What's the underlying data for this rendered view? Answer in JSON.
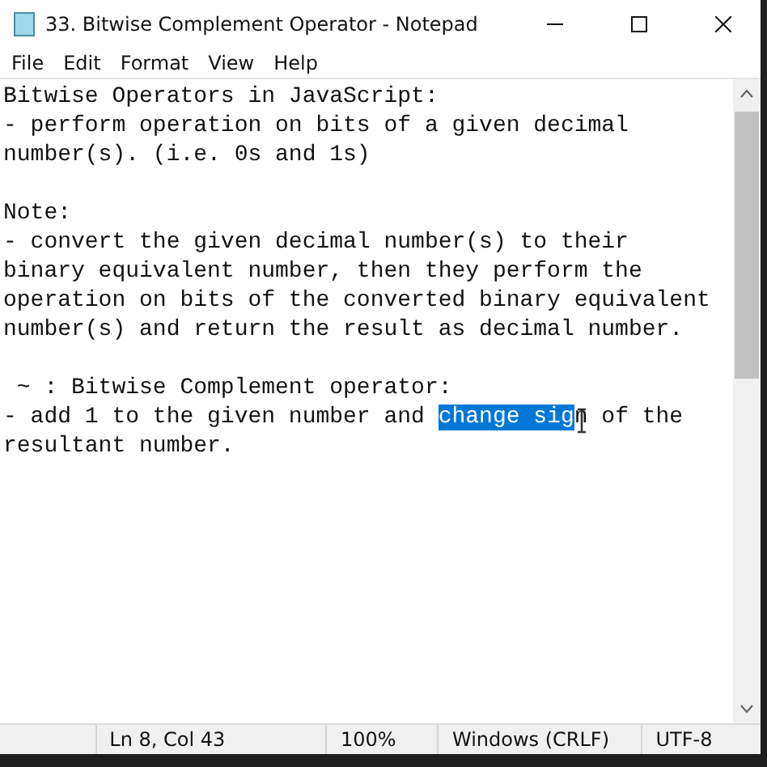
{
  "window": {
    "title": "33. Bitwise Complement Operator - Notepad"
  },
  "menu": [
    "File",
    "Edit",
    "Format",
    "View",
    "Help"
  ],
  "document": {
    "blocks": [
      {
        "lines": [
          [
            {
              "text": "Bitwise Operators in JavaScript:",
              "selected": false
            }
          ],
          [
            {
              "text": "- perform operation on bits of a given decimal",
              "selected": false
            }
          ],
          [
            {
              "text": "number(s). (i.e. 0s and 1s)",
              "selected": false
            }
          ]
        ]
      },
      {
        "lines": [
          [
            {
              "text": "Note:",
              "selected": false
            }
          ],
          [
            {
              "text": "- convert the given decimal number(s) to their",
              "selected": false
            }
          ],
          [
            {
              "text": "binary equivalent number, then they perform the",
              "selected": false
            }
          ],
          [
            {
              "text": "operation on bits of the converted binary equivalent",
              "selected": false
            }
          ],
          [
            {
              "text": "number(s) and return the result as decimal number.",
              "selected": false
            }
          ]
        ]
      },
      {
        "lines": [
          [
            {
              "text": " ~ : Bitwise Complement operator:",
              "selected": false
            }
          ],
          [
            {
              "text": "- add 1 to the given number and ",
              "selected": false
            },
            {
              "text": "change sig",
              "selected": true
            },
            {
              "text": "n of the",
              "selected": false
            }
          ],
          [
            {
              "text": "resultant number.",
              "selected": false
            }
          ]
        ]
      }
    ]
  },
  "status_bar": {
    "position": "Ln 8, Col 43",
    "zoom": "100%",
    "line_ending": "Windows (CRLF)",
    "encoding": "UTF-8"
  }
}
